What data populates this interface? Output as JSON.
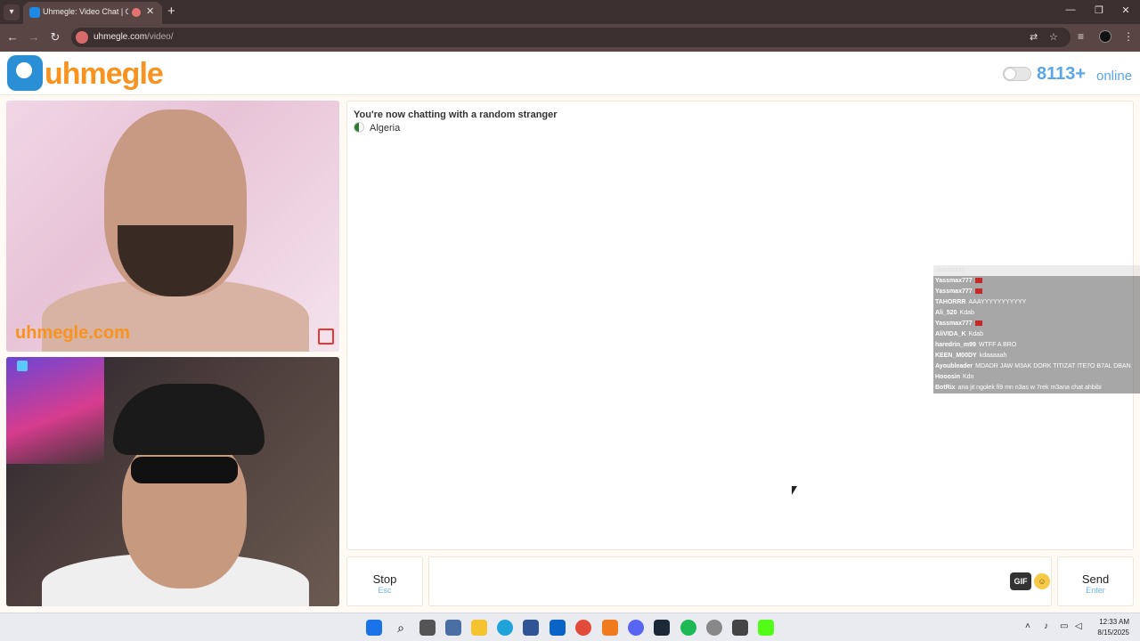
{
  "browser": {
    "tab_title": "Uhmegle: Video Chat | Om",
    "url_host": "uhmegle.com",
    "url_path": "/video/",
    "new_tab_symbol": "+",
    "close_symbol": "✕"
  },
  "site": {
    "logo_text": "uhmegle",
    "online_count": "8113+",
    "online_label": "online",
    "watermark": "uhmegle.com"
  },
  "chat": {
    "status": "You're now chatting with a random stranger",
    "country": "Algeria"
  },
  "overlay": {
    "header": "Streamelo",
    "rows": [
      {
        "user": "Yassmax777",
        "text": ""
      },
      {
        "user": "Yassmax777",
        "text": ""
      },
      {
        "user": "TAHORRR",
        "text": "AAAYYYYYYYYYYY"
      },
      {
        "user": "Ali_520",
        "text": "Kdab"
      },
      {
        "user": "Yassmax777",
        "text": ""
      },
      {
        "user": "AliVIDA_K",
        "text": "Kdab"
      },
      {
        "user": "haredrin_m99",
        "text": "WTFF A BRO"
      },
      {
        "user": "KEEN_M00DY",
        "text": "kdaaaaah"
      },
      {
        "user": "Ayoubleader",
        "text": "MDADR JAW M3AK DORK TITIZAT ITE7O B7AL DBAN"
      },
      {
        "user": "Hooosin",
        "text": "Kdn"
      },
      {
        "user": "BotRix",
        "text": "ana jit ngolek fi9 mn n3as w 7rek m3ana chat ahbibi"
      }
    ]
  },
  "controls": {
    "stop_label": "Stop",
    "stop_hint": "Esc",
    "gif_label": "GIF",
    "send_label": "Send",
    "send_hint": "Enter",
    "message_value": ""
  },
  "taskbar": {
    "time": "12:33 AM",
    "date": "8/15/2025"
  },
  "colors": {
    "brand_orange": "#f7931e",
    "brand_blue": "#2b8fd6",
    "hint_blue": "#6bb6f0"
  }
}
